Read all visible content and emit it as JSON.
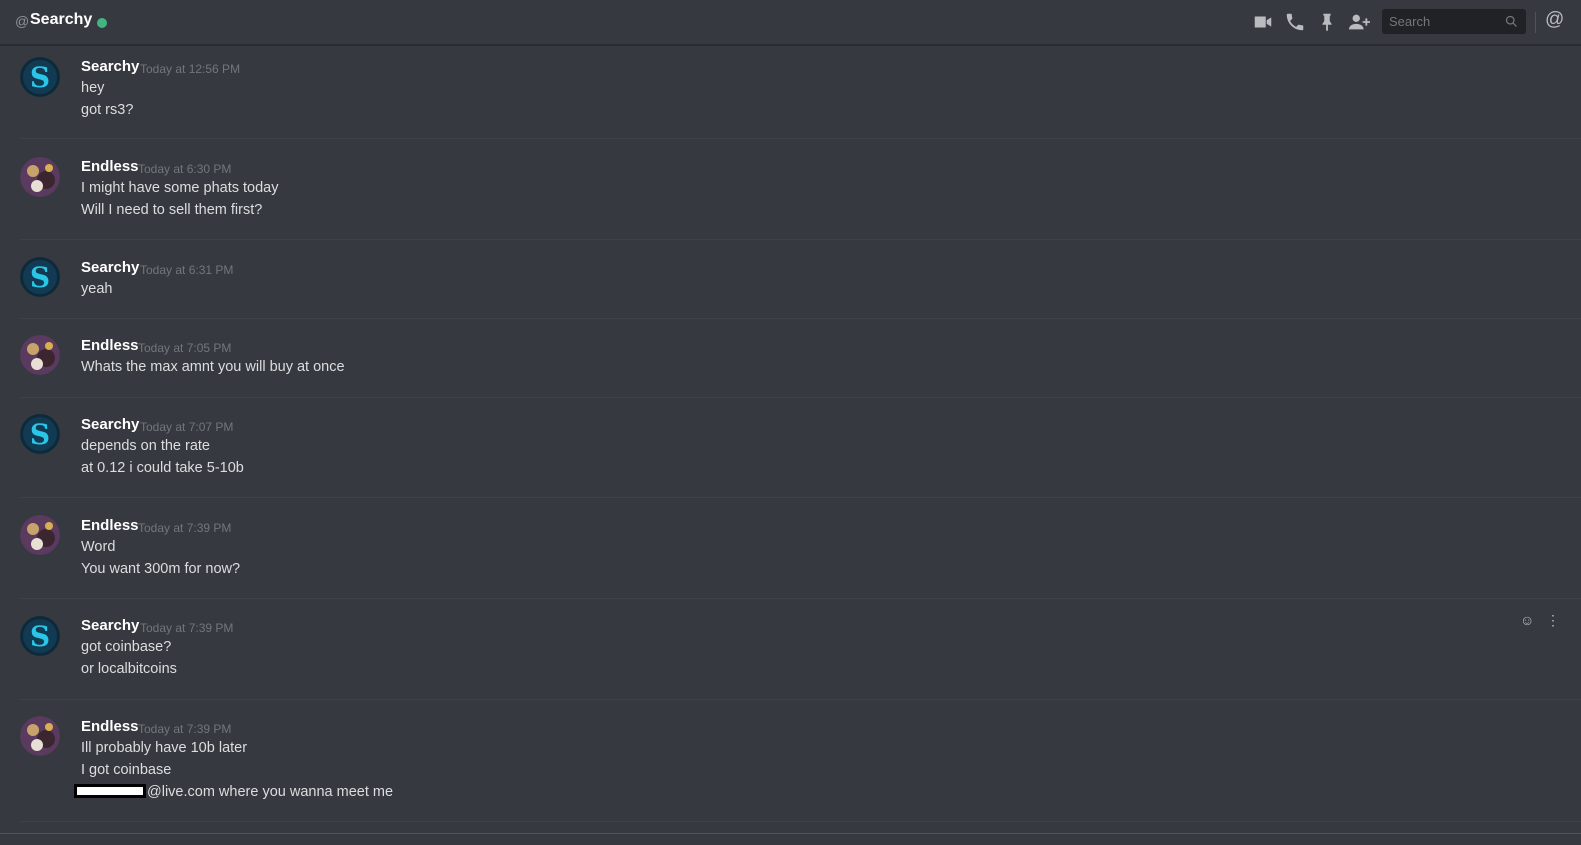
{
  "header": {
    "at_symbol": "@",
    "channel_name": "Searchy",
    "status": "online",
    "status_color": "#43b581",
    "mention_label": "@"
  },
  "toolbar": {
    "icons": [
      "video-call-icon",
      "voice-call-icon",
      "pin-icon",
      "add-friend-icon"
    ]
  },
  "search": {
    "placeholder": "Search",
    "value": ""
  },
  "messages": [
    {
      "author": "Searchy",
      "timestamp": "Today at 12:56 PM",
      "avatar": "searchy-avatar",
      "lines": [
        "hey",
        "got rs3?"
      ]
    },
    {
      "author": "Endless",
      "timestamp": "Today at 6:30 PM",
      "avatar": "endless-avatar",
      "lines": [
        "I might have some phats today",
        "Will I need to sell them first?"
      ]
    },
    {
      "author": "Searchy",
      "timestamp": "Today at 6:31 PM",
      "avatar": "searchy-avatar",
      "lines": [
        "yeah"
      ]
    },
    {
      "author": "Endless",
      "timestamp": "Today at 7:05 PM",
      "avatar": "endless-avatar",
      "lines": [
        "Whats the max amnt you will buy at once"
      ]
    },
    {
      "author": "Searchy",
      "timestamp": "Today at 7:07 PM",
      "avatar": "searchy-avatar",
      "lines": [
        "depends on the rate",
        "at 0.12 i could take 5-10b"
      ]
    },
    {
      "author": "Endless",
      "timestamp": "Today at 7:39 PM",
      "avatar": "endless-avatar",
      "lines": [
        "Word",
        "You want 300m for now?"
      ]
    },
    {
      "author": "Searchy",
      "timestamp": "Today at 7:39 PM",
      "avatar": "searchy-avatar",
      "lines": [
        "got coinbase?",
        "or localbitcoins"
      ]
    },
    {
      "author": "Endless",
      "timestamp": "Today at 7:39 PM",
      "avatar": "endless-avatar",
      "lines": [
        "Ill probably have 10b later",
        "I got coinbase",
        "@live.com where you wanna meet me"
      ]
    }
  ],
  "hover_actions": {
    "icons": [
      "add-reaction-icon",
      "more-options-icon"
    ],
    "reaction_glyph": "☺",
    "more_glyph": "⋮"
  },
  "colors": {
    "background": "#36393f",
    "author": "#ffffff",
    "timestamp": "#72767d",
    "text": "#dcddde"
  }
}
